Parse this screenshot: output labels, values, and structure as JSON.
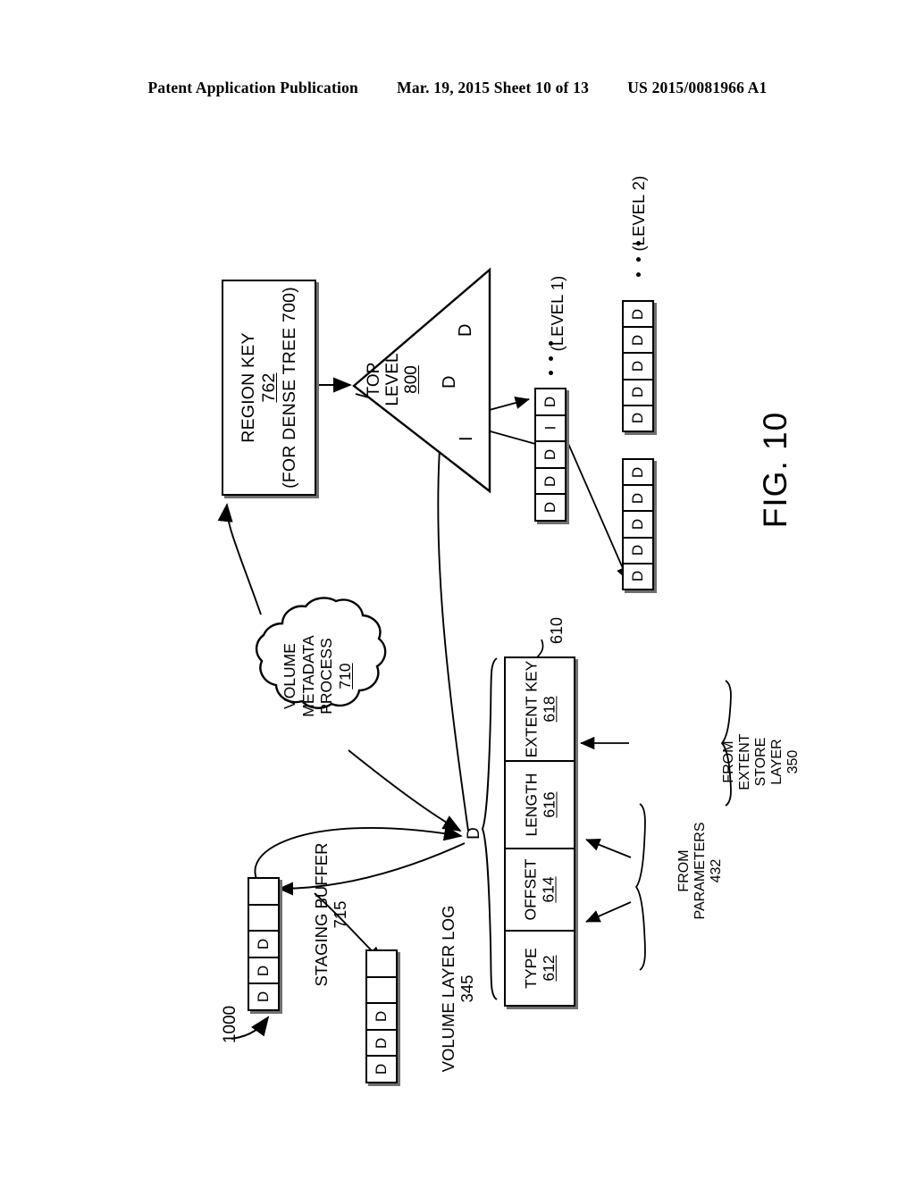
{
  "header": {
    "publication": "Patent Application Publication",
    "date_sheet": "Mar. 19, 2015  Sheet 10 of 13",
    "patent_number": "US 2015/0081966 A1"
  },
  "figure": {
    "label": "FIG. 10",
    "reference_numeral": "1000"
  },
  "region_key_box": {
    "title": "REGION KEY",
    "numeral": "762",
    "subtitle": "(FOR DENSE TREE 700)"
  },
  "cloud": {
    "line1": "VOLUME",
    "line2": "METADATA",
    "line3": "PROCESS",
    "numeral": "710"
  },
  "top_level": {
    "line1": "TOP",
    "line2": "LEVEL",
    "numeral": "800",
    "entries": [
      "D",
      "D",
      "I"
    ]
  },
  "level1": {
    "label": "(LEVEL 1)",
    "cells": [
      "D",
      "D",
      "D",
      "I",
      "D"
    ]
  },
  "level2": {
    "label": "(LEVEL 2)",
    "upper_cells": [
      "D",
      "D",
      "D",
      "D",
      "D"
    ],
    "lower_cells": [
      "D",
      "D",
      "D",
      "D",
      "D"
    ]
  },
  "staging_buffer": {
    "label_line1": "STAGING BUFFER",
    "numeral": "715",
    "cells": [
      "D",
      "D",
      "D",
      "",
      ""
    ]
  },
  "volume_layer_log": {
    "label_line1": "VOLUME LAYER LOG",
    "numeral": "345",
    "cells": [
      "D",
      "D",
      "D",
      "",
      ""
    ]
  },
  "entry": {
    "reference_numeral": "610",
    "brace_label": "D",
    "fields": [
      {
        "name": "TYPE",
        "numeral": "612"
      },
      {
        "name": "OFFSET",
        "numeral": "614"
      },
      {
        "name": "LENGTH",
        "numeral": "616"
      },
      {
        "name": "EXTENT KEY",
        "numeral": "618"
      }
    ]
  },
  "annotations": {
    "from_parameters": {
      "line1": "FROM",
      "line2": "PARAMETERS",
      "numeral": "432"
    },
    "from_extent_store": {
      "line1": "FROM",
      "line2": "EXTENT",
      "line3": "STORE",
      "line4": "LAYER",
      "numeral": "350"
    }
  },
  "colors": {
    "ink": "#000000",
    "shadow": "#6f6f6f",
    "paper": "#ffffff"
  }
}
